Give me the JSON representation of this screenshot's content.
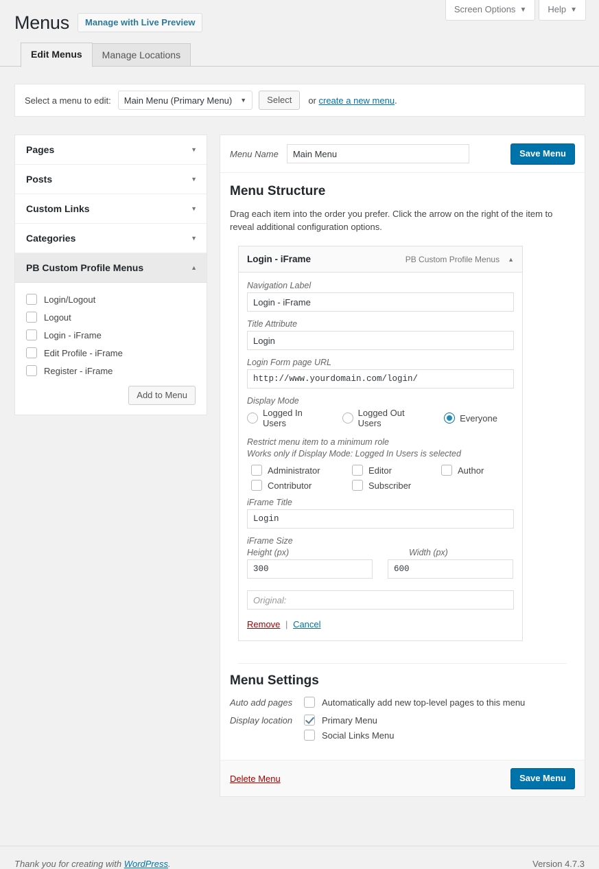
{
  "header": {
    "title": "Menus",
    "live_preview_label": "Manage with Live Preview",
    "screen_options_label": "Screen Options",
    "help_label": "Help",
    "caret_down": "▼"
  },
  "tabs": [
    {
      "label": "Edit Menus",
      "active": true
    },
    {
      "label": "Manage Locations",
      "active": false
    }
  ],
  "menu_select": {
    "label": "Select a menu to edit:",
    "selected": "Main Menu (Primary Menu)",
    "caret": "▼",
    "select_button": "Select",
    "or_text": "or",
    "create_link": "create a new menu",
    "trailing_period": "."
  },
  "sidebar": {
    "panels": [
      {
        "label": "Pages",
        "arrow": "▼",
        "open": false
      },
      {
        "label": "Posts",
        "arrow": "▼",
        "open": false
      },
      {
        "label": "Custom Links",
        "arrow": "▼",
        "open": false
      },
      {
        "label": "Categories",
        "arrow": "▼",
        "open": false
      },
      {
        "label": "PB Custom Profile Menus",
        "arrow": "▲",
        "open": true
      }
    ],
    "items": [
      {
        "label": "Login/Logout",
        "checked": false
      },
      {
        "label": "Logout",
        "checked": false
      },
      {
        "label": "Login - iFrame",
        "checked": false
      },
      {
        "label": "Edit Profile - iFrame",
        "checked": false
      },
      {
        "label": "Register - iFrame",
        "checked": false
      }
    ],
    "add_button": "Add to Menu"
  },
  "menu_name": {
    "label": "Menu Name",
    "value": "Main Menu",
    "save_label": "Save Menu"
  },
  "structure": {
    "title": "Menu Structure",
    "description": "Drag each item into the order you prefer. Click the arrow on the right of the item to reveal additional configuration options."
  },
  "menu_item": {
    "title": "Login - iFrame",
    "type": "PB Custom Profile Menus",
    "caret": "▲",
    "nav_label_label": "Navigation Label",
    "nav_label_value": "Login - iFrame",
    "title_attr_label": "Title Attribute",
    "title_attr_value": "Login",
    "url_label": "Login Form page URL",
    "url_value": "http://www.yourdomain.com/login/",
    "display_mode_label": "Display Mode",
    "display_modes": [
      {
        "label": "Logged In Users",
        "selected": false
      },
      {
        "label": "Logged Out Users",
        "selected": false
      },
      {
        "label": "Everyone",
        "selected": true
      }
    ],
    "restrict_line1": "Restrict menu item to a minimum role",
    "restrict_line2": "Works only if Display Mode: Logged In Users is selected",
    "roles": [
      {
        "label": "Administrator",
        "checked": false
      },
      {
        "label": "Editor",
        "checked": false
      },
      {
        "label": "Author",
        "checked": false
      },
      {
        "label": "Contributor",
        "checked": false
      },
      {
        "label": "Subscriber",
        "checked": false
      }
    ],
    "iframe_title_label": "iFrame Title",
    "iframe_title_value": "Login",
    "iframe_size_label": "iFrame Size",
    "height_label": "Height (px)",
    "height_value": "300",
    "width_label": "Width (px)",
    "width_value": "600",
    "original_placeholder": "Original:",
    "original_value": "",
    "remove_label": "Remove",
    "pipe": "|",
    "cancel_label": "Cancel"
  },
  "menu_settings": {
    "title": "Menu Settings",
    "auto_add_label": "Auto add pages",
    "auto_add_option": {
      "label": "Automatically add new top-level pages to this menu",
      "checked": false
    },
    "display_location_label": "Display location",
    "locations": [
      {
        "label": "Primary Menu",
        "checked": true
      },
      {
        "label": "Social Links Menu",
        "checked": false
      }
    ],
    "delete_label": "Delete Menu",
    "save_label": "Save Menu"
  },
  "page_footer": {
    "thanks_prefix": "Thank you for creating with ",
    "wordpress_link": "WordPress",
    "thanks_suffix": ".",
    "version": "Version 4.7.3"
  },
  "colors": {
    "accent": "#0073aa",
    "link": "#0073aa",
    "danger": "#a00",
    "page_bg": "#f1f1f1",
    "panel_bg": "#ffffff"
  }
}
